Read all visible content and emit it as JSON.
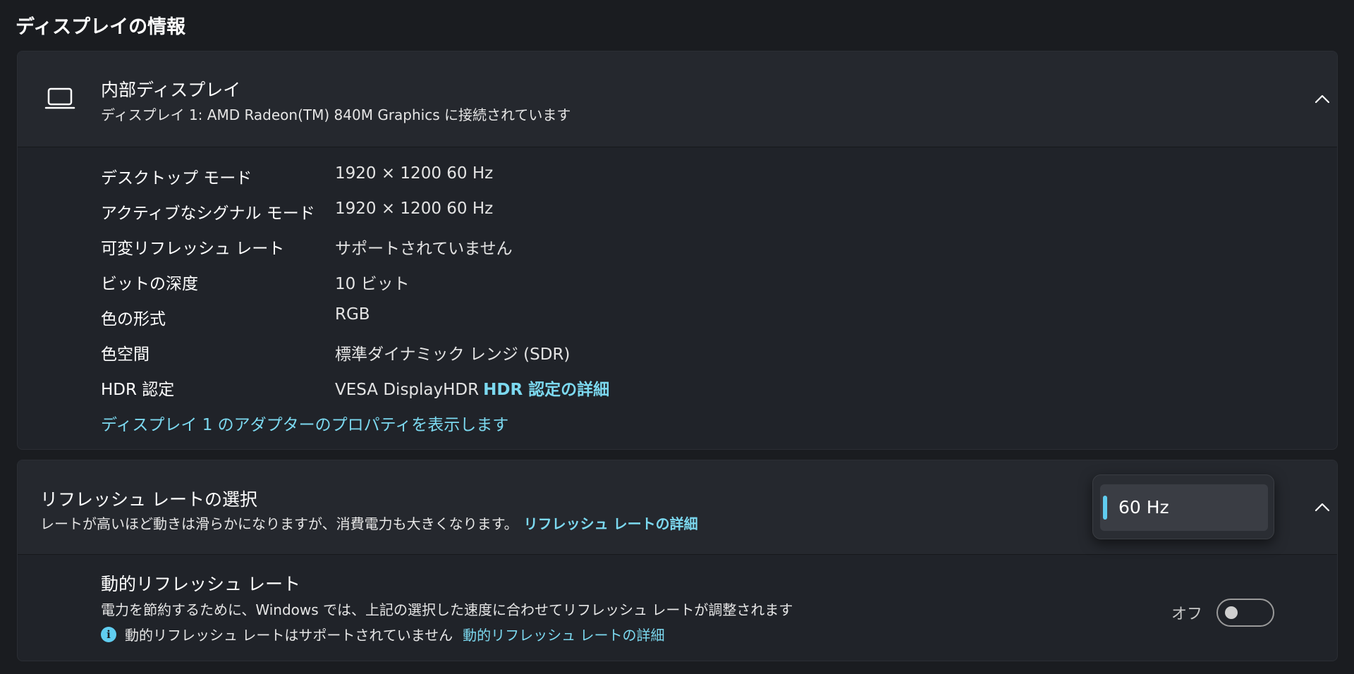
{
  "page": {
    "title": "ディスプレイの情報"
  },
  "internal_display": {
    "title": "内部ディスプレイ",
    "subtitle": "ディスプレイ 1: AMD Radeon(TM) 840M Graphics に接続されています",
    "expanded": true,
    "icon": "laptop-icon",
    "rows": [
      {
        "label": "デスクトップ モード",
        "value": "1920 × 1200 60 Hz"
      },
      {
        "label": "アクティブなシグナル モード",
        "value": "1920 × 1200 60 Hz"
      },
      {
        "label": "可変リフレッシュ レート",
        "value": "サポートされていません"
      },
      {
        "label": "ビットの深度",
        "value": "10 ビット"
      },
      {
        "label": "色の形式",
        "value": "RGB"
      },
      {
        "label": "色空間",
        "value": "標準ダイナミック レンジ (SDR)"
      },
      {
        "label": "HDR 認定",
        "value": "VESA DisplayHDR",
        "link": "HDR 認定の詳細"
      }
    ],
    "adapter_link": "ディスプレイ 1 のアダプターのプロパティを表示します"
  },
  "refresh_rate": {
    "title": "リフレッシュ レートの選択",
    "subtitle": "レートが高いほど動きは滑らかになりますが、消費電力も大きくなります。",
    "subtitle_link": "リフレッシュ レートの詳細",
    "selected": "60 Hz",
    "expanded": true,
    "dynamic": {
      "title": "動的リフレッシュ レート",
      "description": "電力を節約するために、Windows では、上記の選択した速度に合わせてリフレッシュ レートが調整されます",
      "note": "動的リフレッシュ レートはサポートされていません",
      "note_link": "動的リフレッシュ レートの詳細",
      "toggle_label": "オフ",
      "toggle_on": false
    }
  },
  "colors": {
    "accent": "#60cdf0",
    "link": "#7cd9f0",
    "card_bg": "#202329",
    "header_bg": "#25282e"
  }
}
